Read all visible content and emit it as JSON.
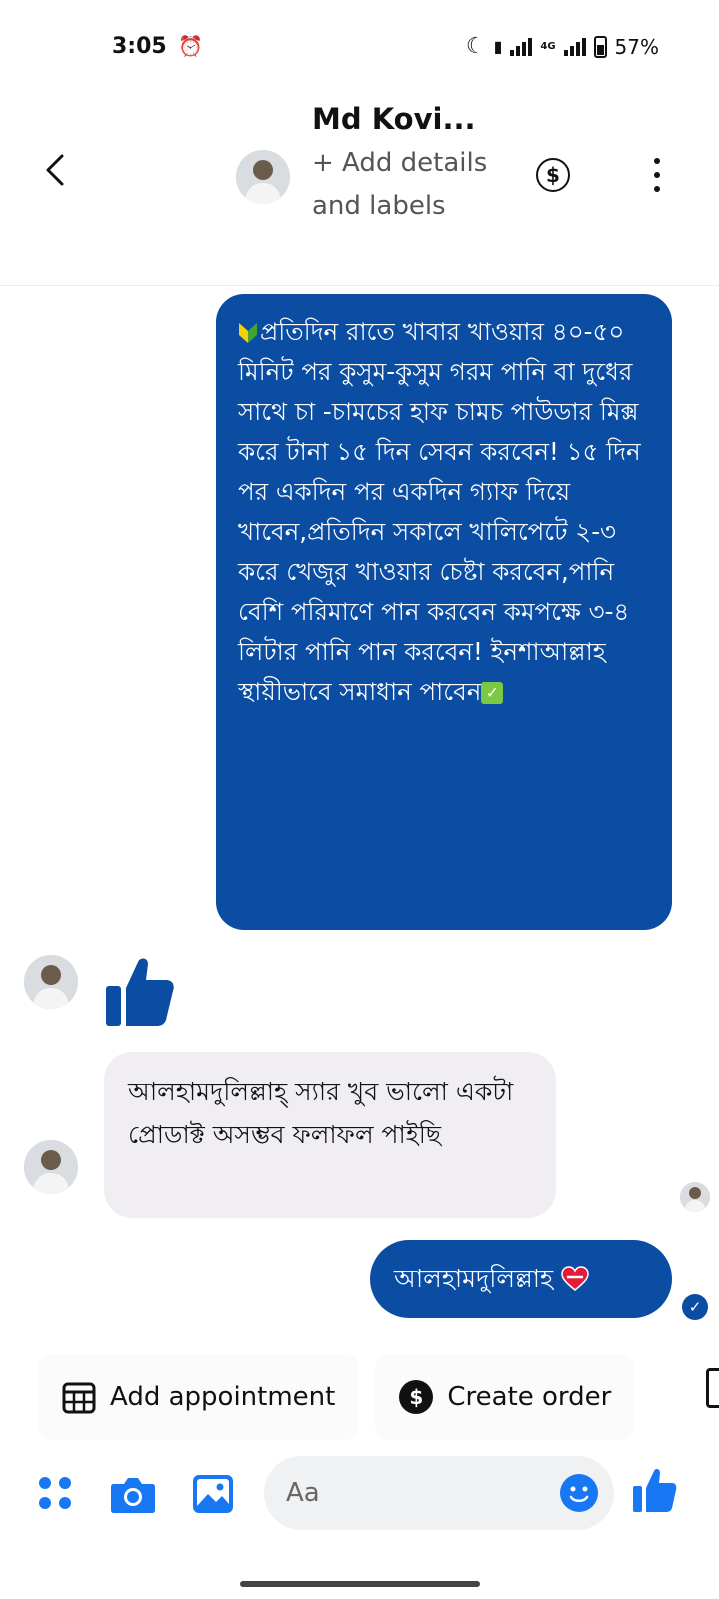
{
  "status_bar": {
    "time": "3:05",
    "battery": "57%",
    "network": "4G"
  },
  "header": {
    "contact_name": "Md Kovi...",
    "subtitle": "+ Add details and labels",
    "dollar_symbol": "$"
  },
  "messages": [
    {
      "direction": "outgoing",
      "text": "প্রতিদিন রাতে খাবার খাওয়ার ৪০-৫০ মিনিট পর কুসুম-কুসুম গরম পানি বা দুধের সাথে চা -চামচের হাফ  চামচ পাউডার মিক্স করে  টানা ১৫ দিন সেবন করবেন! ১৫ দিন পর একদিন পর একদিন গ্যাফ দিয়ে খাবেন,প্রতিদিন সকালে খালিপেটে ২-৩ করে খেজুর খাওয়ার চেষ্টা করবেন,পানি বেশি পরিমাণে পান করবেন কমপক্ষে ৩-৪ লিটার পানি পান করবেন! ইনশাআল্লাহ স্থায়ীভাবে সমাধান পাবেন",
      "check_badge": "✓"
    },
    {
      "direction": "incoming",
      "type": "like"
    },
    {
      "direction": "incoming",
      "text": "আলহামদুলিল্লাহ্ স্যার খুব ভালো একটা প্রোডাক্ট অসম্ভব ফলাফল পাইছি"
    },
    {
      "direction": "outgoing",
      "text": "আলহামদুলিল্লাহ",
      "seen": true
    }
  ],
  "quick_actions": [
    {
      "label": "Add appointment",
      "icon": "calendar-icon"
    },
    {
      "label": "Create order",
      "icon": "dollar-icon",
      "icon_text": "$"
    }
  ],
  "composer": {
    "placeholder": "Aa"
  },
  "colors": {
    "accent": "#0a4da3",
    "incoming_bubble": "#f0eef2",
    "messenger_blue": "#1877f2"
  }
}
